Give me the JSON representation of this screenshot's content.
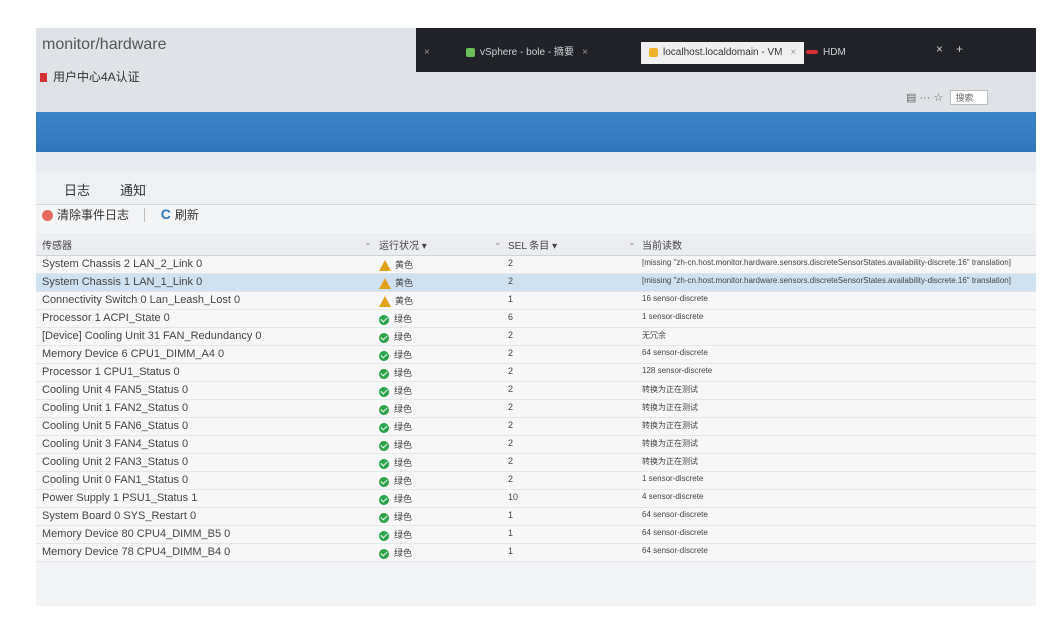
{
  "browser": {
    "url_fragment": "monitor/hardware",
    "bookmark": "用户中心4A认证",
    "tabs": [
      {
        "label": "vSphere - bole - 摘要",
        "favicon": "vsphere-icon"
      },
      {
        "label": "localhost.localdomain - VM",
        "favicon": "vmware-icon",
        "active": true
      },
      {
        "label": "HDM",
        "favicon": "hdm-icon"
      }
    ],
    "new_tab": "+",
    "close_glyph": "×",
    "search_placeholder": "搜索",
    "toolbar_glyphs": {
      "reader": "▤",
      "more": "···",
      "star": "☆"
    }
  },
  "tabs": [
    "日志",
    "通知"
  ],
  "actions": {
    "clear": "清除事件日志",
    "refresh": "刷新"
  },
  "columns": {
    "sensor": "传感器",
    "status": "运行状况 ▾",
    "sel": "SEL 条目 ▾",
    "value": "当前读数"
  },
  "column_caret": "⌄",
  "rows": [
    {
      "name": "System Chassis 2 LAN_2_Link 0",
      "status": "黄色",
      "level": "warning",
      "sel": "2",
      "value": "[missing \"zh-cn.host.monitor.hardware.sensors.discreteSensorStates.availability-discrete.16\" translation]"
    },
    {
      "name": "System Chassis 1 LAN_1_Link 0",
      "status": "黄色",
      "level": "warning",
      "sel": "2",
      "value": "[missing \"zh-cn.host.monitor.hardware.sensors.discreteSensorStates.availability-discrete.16\" translation]"
    },
    {
      "name": "Connectivity Switch 0 Lan_Leash_Lost 0",
      "status": "黄色",
      "level": "warning",
      "sel": "1",
      "value": "16 sensor-discrete"
    },
    {
      "name": "Processor 1 ACPI_State 0",
      "status": "绿色",
      "level": "ok",
      "sel": "6",
      "value": "1 sensor-discrete"
    },
    {
      "name": "[Device] Cooling Unit 31 FAN_Redundancy 0",
      "status": "绿色",
      "level": "ok",
      "sel": "2",
      "value": "无冗余"
    },
    {
      "name": "Memory Device 6 CPU1_DIMM_A4 0",
      "status": "绿色",
      "level": "ok",
      "sel": "2",
      "value": "64 sensor-discrete"
    },
    {
      "name": "Processor 1 CPU1_Status 0",
      "status": "绿色",
      "level": "ok",
      "sel": "2",
      "value": "128 sensor-discrete"
    },
    {
      "name": "Cooling Unit 4 FAN5_Status 0",
      "status": "绿色",
      "level": "ok",
      "sel": "2",
      "value": "转换为正在测试"
    },
    {
      "name": "Cooling Unit 1 FAN2_Status 0",
      "status": "绿色",
      "level": "ok",
      "sel": "2",
      "value": "转换为正在测试"
    },
    {
      "name": "Cooling Unit 5 FAN6_Status 0",
      "status": "绿色",
      "level": "ok",
      "sel": "2",
      "value": "转换为正在测试"
    },
    {
      "name": "Cooling Unit 3 FAN4_Status 0",
      "status": "绿色",
      "level": "ok",
      "sel": "2",
      "value": "转换为正在测试"
    },
    {
      "name": "Cooling Unit 2 FAN3_Status 0",
      "status": "绿色",
      "level": "ok",
      "sel": "2",
      "value": "转换为正在测试"
    },
    {
      "name": "Cooling Unit 0 FAN1_Status 0",
      "status": "绿色",
      "level": "ok",
      "sel": "2",
      "value": "1 sensor-discrete"
    },
    {
      "name": "Power Supply 1 PSU1_Status 1",
      "status": "绿色",
      "level": "ok",
      "sel": "10",
      "value": "4 sensor-discrete"
    },
    {
      "name": "System Board 0 SYS_Restart 0",
      "status": "绿色",
      "level": "ok",
      "sel": "1",
      "value": "64 sensor-discrete"
    },
    {
      "name": "Memory Device 80 CPU4_DIMM_B5 0",
      "status": "绿色",
      "level": "ok",
      "sel": "1",
      "value": "64 sensor-discrete"
    },
    {
      "name": "Memory Device 78 CPU4_DIMM_B4 0",
      "status": "绿色",
      "level": "ok",
      "sel": "1",
      "value": "64 sensor-discrete"
    }
  ],
  "selected_row_index": 1,
  "colors": {
    "header_blue": "#2f76b9",
    "warning": "#e0a21a",
    "ok": "#2aa34a",
    "selected_row": "#cfe2f2"
  }
}
